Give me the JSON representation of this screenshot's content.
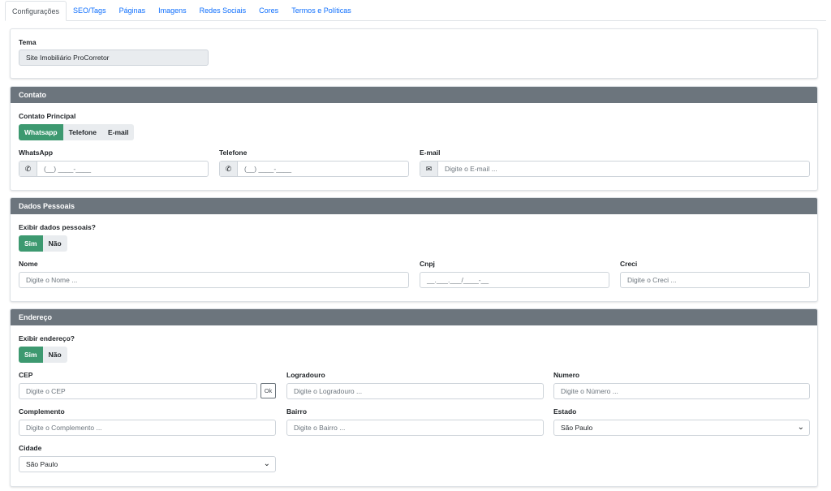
{
  "tabs": [
    {
      "label": "Configurações"
    },
    {
      "label": "SEO/Tags"
    },
    {
      "label": "Páginas"
    },
    {
      "label": "Imagens"
    },
    {
      "label": "Redes Sociais"
    },
    {
      "label": "Cores"
    },
    {
      "label": "Termos e Políticas"
    }
  ],
  "tema": {
    "label": "Tema",
    "value": "Site Imobiliário ProCorretor"
  },
  "contato": {
    "title": "Contato",
    "principal_label": "Contato Principal",
    "options": [
      "Whatsapp",
      "Telefone",
      "E-mail"
    ],
    "whatsapp_label": "WhatsApp",
    "whatsapp_placeholder": "(__) ____-____",
    "telefone_label": "Telefone",
    "telefone_placeholder": "(__) ____-____",
    "email_label": "E-mail",
    "email_placeholder": "Digite o E-mail ..."
  },
  "dados": {
    "title": "Dados Pessoais",
    "exibir_label": "Exibir dados pessoais?",
    "sim": "Sim",
    "nao": "Não",
    "nome_label": "Nome",
    "nome_placeholder": "Digite o Nome ...",
    "cnpj_label": "Cnpj",
    "cnpj_placeholder": "__.___.___/____-__",
    "creci_label": "Creci",
    "creci_placeholder": "Digite o Creci ..."
  },
  "endereco": {
    "title": "Endereço",
    "exibir_label": "Exibir endereço?",
    "sim": "Sim",
    "nao": "Não",
    "cep_label": "CEP",
    "cep_placeholder": "Digite o CEP",
    "ok_label": "Ok",
    "logradouro_label": "Logradouro",
    "logradouro_placeholder": "Digite o Logradouro ...",
    "numero_label": "Numero",
    "numero_placeholder": "Digite o Número ...",
    "complemento_label": "Complemento",
    "complemento_placeholder": "Digite o Complemento ...",
    "bairro_label": "Bairro",
    "bairro_placeholder": "Digite o Bairro ...",
    "estado_label": "Estado",
    "estado_value": "São Paulo",
    "cidade_label": "Cidade",
    "cidade_value": "São Paulo"
  },
  "colors": {
    "accent": "#3d9970",
    "header": "#6c757d",
    "link": "#0d6efd"
  }
}
